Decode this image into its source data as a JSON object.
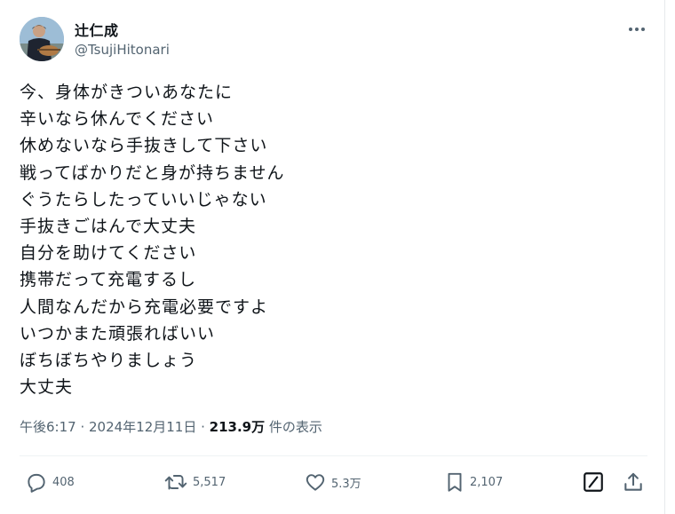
{
  "author": {
    "display_name": "辻仁成",
    "handle": "@TsujiHitonari"
  },
  "tweet": {
    "lines": [
      "今、身体がきついあなたに",
      "辛いなら休んでください",
      "休めないなら手抜きして下さい",
      "戦ってばかりだと身が持ちません",
      "ぐうたらしたっていいじゃない",
      "手抜きごはんで大丈夫",
      "自分を助けてください",
      "携帯だって充電するし",
      "人間なんだから充電必要ですよ",
      "いつかまた頑張ればいい",
      "ぼちぼちやりましょう",
      "大丈夫"
    ]
  },
  "meta": {
    "time": "午後6:17",
    "separator": " · ",
    "date": "2024年12月11日",
    "views": "213.9万",
    "views_suffix": " 件の表示"
  },
  "actions": {
    "replies": "408",
    "retweets": "5,517",
    "likes": "5.3万",
    "bookmarks": "2,107"
  },
  "icons": [
    "more-icon",
    "reply-icon",
    "retweet-icon",
    "like-icon",
    "bookmark-icon",
    "grok-icon",
    "share-icon"
  ]
}
